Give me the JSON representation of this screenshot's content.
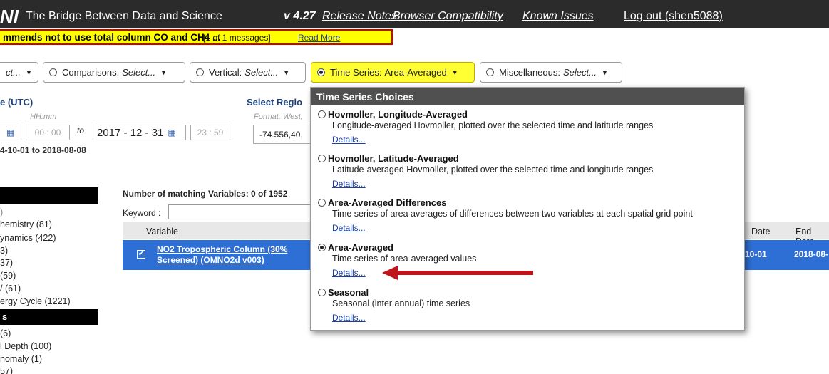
{
  "header": {
    "logo": "NI",
    "tagline": "The Bridge Between Data and Science",
    "version": "v 4.27",
    "links": [
      "Release Notes",
      "Browser Compatibility",
      "Known Issues"
    ],
    "logout": "Log out (shen5088)"
  },
  "alert": {
    "text": "mmends not to use total column CO and CH4 ...",
    "count": "[1 of 1 messages]",
    "read_more": "Read More"
  },
  "plot_selectors": [
    {
      "label": "",
      "value": "ct...",
      "selected": false
    },
    {
      "label": "Comparisons:",
      "value": "Select...",
      "selected": false
    },
    {
      "label": "Vertical:",
      "value": "Select...",
      "selected": false
    },
    {
      "label": "Time Series:",
      "value": "Area-Averaged",
      "selected": true
    },
    {
      "label": "Miscellaneous:",
      "value": "Select...",
      "selected": false
    }
  ],
  "date": {
    "title": "e (UTC)",
    "time_hint": "HH:mm",
    "start_time": "00 : 00",
    "to_label": "to",
    "end_date": "2017 - 12 - 31",
    "end_time": "23 : 59",
    "valid_range": "4-10-01 to 2018-08-08"
  },
  "region": {
    "title": "Select Regio",
    "format_hint": "Format: West,",
    "value": "-74.556,40."
  },
  "facets": {
    "items_a": [
      "hemistry (81)",
      "ynamics (422)",
      "3)",
      "37)",
      "(59)",
      "/ (61)",
      "ergy Cycle (1221)"
    ],
    "header_b": "s",
    "items_b": [
      "(6)",
      "l Depth (100)",
      "nomaly (1)",
      "57)"
    ]
  },
  "variables": {
    "matching": "Number of matching Variables: 0 of 1952",
    "keyword_label": "Keyword :",
    "columns": [
      "Variable",
      "Date",
      "End Date"
    ],
    "row": {
      "name_line1": "NO2 Tropospheric Column (30%",
      "name_line2": "Screened)  (OMNO2d v003)",
      "begin_date": "10-01",
      "end_date": "2018-08-"
    }
  },
  "time_series_panel": {
    "title": "Time Series Choices",
    "details_label": "Details...",
    "choices": [
      {
        "name": "Hovmoller, Longitude-Averaged",
        "desc": "Longitude-averaged Hovmoller, plotted over the selected time and latitude ranges",
        "selected": false
      },
      {
        "name": "Hovmoller, Latitude-Averaged",
        "desc": "Latitude-averaged Hovmoller, plotted over the selected time and longitude ranges",
        "selected": false
      },
      {
        "name": "Area-Averaged Differences",
        "desc": "Time series of area averages of differences between two variables at each spatial grid point",
        "selected": false
      },
      {
        "name": "Area-Averaged",
        "desc": "Time series of area-averaged values",
        "selected": true
      },
      {
        "name": "Seasonal",
        "desc": "Seasonal (inter annual) time series",
        "selected": false
      }
    ]
  },
  "colors": {
    "header_bg": "#2b2b2b",
    "alert_bg": "#ffff00",
    "alert_border": "#d40000",
    "active_button": "#ffff33",
    "selected_row": "#2e6fd6",
    "panel_header": "#505050",
    "arrow": "#c0141c"
  }
}
